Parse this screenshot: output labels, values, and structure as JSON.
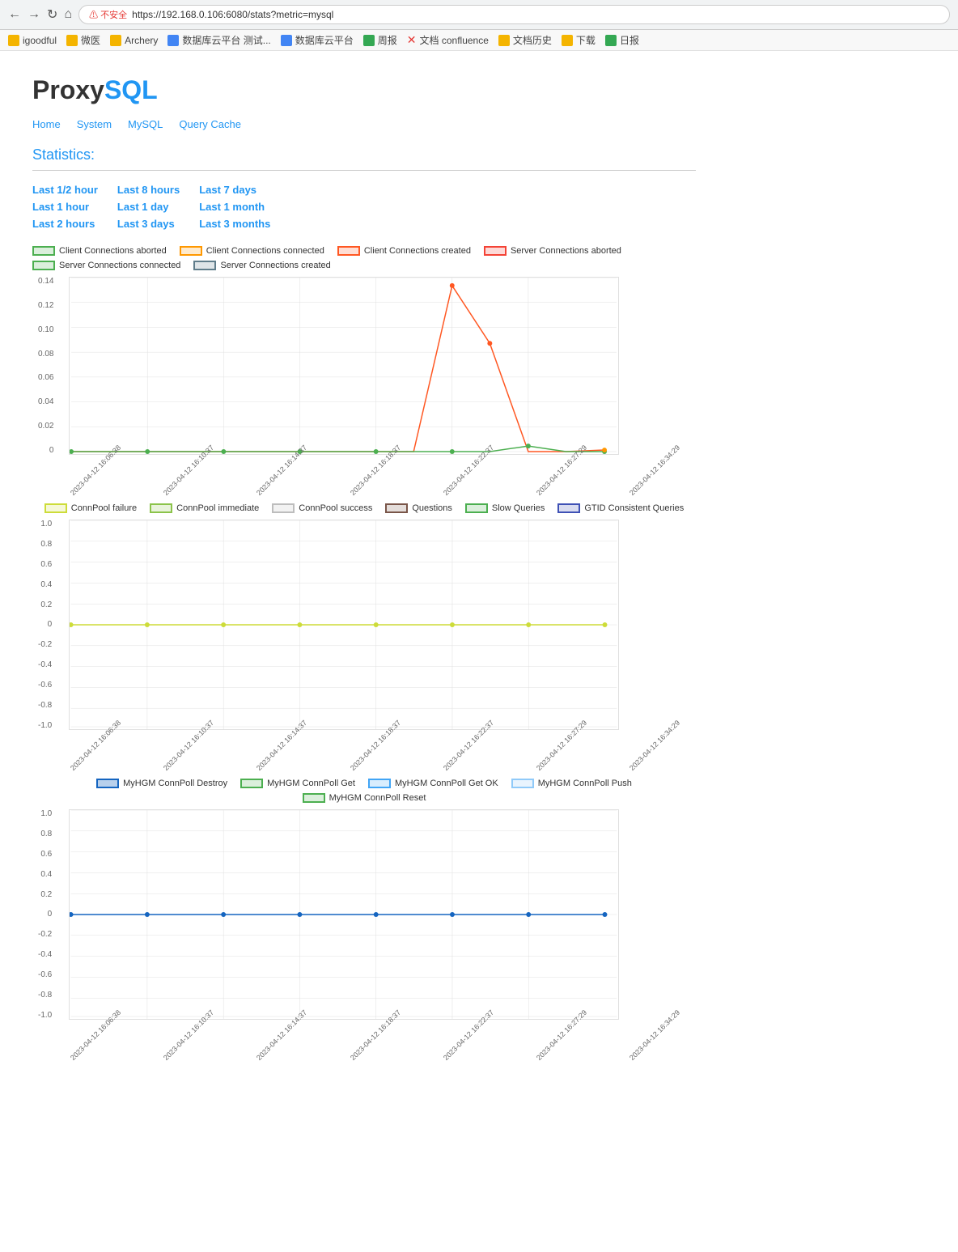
{
  "browser": {
    "back_label": "←",
    "forward_label": "→",
    "reload_label": "↻",
    "home_label": "⌂",
    "warning_text": "⚠ 不安全",
    "url": "https://192.168.0.106:6080/stats?metric=mysql",
    "bookmarks": [
      {
        "label": "igoodful",
        "color": "#f4b400"
      },
      {
        "label": "微医",
        "color": "#f4b400"
      },
      {
        "label": "Archery",
        "color": "#f4b400"
      },
      {
        "label": "数据库云平台 测试...",
        "color": "#4285f4"
      },
      {
        "label": "数据库云平台",
        "color": "#4285f4"
      },
      {
        "label": "周报",
        "color": "#34a853"
      },
      {
        "label": "文档 confluence",
        "color": "#4285f4"
      },
      {
        "label": "文档历史",
        "color": "#f4b400"
      },
      {
        "label": "下载",
        "color": "#f4b400"
      },
      {
        "label": "日报",
        "color": "#34a853"
      }
    ]
  },
  "logo": {
    "proxy": "Proxy",
    "sql": "SQL"
  },
  "nav": {
    "items": [
      "Home",
      "System",
      "MySQL",
      "Query Cache"
    ]
  },
  "statistics": {
    "title": "Statistics:"
  },
  "time_links": [
    "Last 1/2 hour",
    "Last 8 hours",
    "Last 7 days",
    "Last 1 hour",
    "Last 1 day",
    "Last 1 month",
    "Last 2 hours",
    "Last 3 days",
    "Last 3 months"
  ],
  "chart1": {
    "legend": [
      {
        "label": "Client Connections aborted",
        "color": "#4caf50",
        "bg": "transparent"
      },
      {
        "label": "Client Connections connected",
        "color": "#ff9800",
        "bg": "transparent"
      },
      {
        "label": "Client Connections created",
        "color": "#ff5722",
        "bg": "transparent"
      },
      {
        "label": "Server Connections aborted",
        "color": "#f44336",
        "bg": "transparent"
      },
      {
        "label": "Server Connections connected",
        "color": "#4caf50",
        "bg": "transparent"
      },
      {
        "label": "Server Connections created",
        "color": "#607d8b",
        "bg": "transparent"
      }
    ],
    "y_labels": [
      "0.14",
      "0.12",
      "0.10",
      "0.08",
      "0.06",
      "0.04",
      "0.02",
      "0"
    ],
    "x_labels": [
      "2023-04-12 16:06:38",
      "2023-04-12 16:10:37",
      "2023-04-12 16:14:37",
      "2023-04-12 16:18:37",
      "2023-04-12 16:22:37",
      "2023-04-12 16:27:29",
      "2023-04-12 16:34:29"
    ]
  },
  "chart2": {
    "legend": [
      {
        "label": "ConnPool failure",
        "color": "#cddc39",
        "bg": "transparent"
      },
      {
        "label": "ConnPool immediate",
        "color": "#8bc34a",
        "bg": "transparent"
      },
      {
        "label": "ConnPool success",
        "color": "#bdbdbd",
        "bg": "transparent"
      },
      {
        "label": "Questions",
        "color": "#795548",
        "bg": "transparent"
      },
      {
        "label": "Slow Queries",
        "color": "#4caf50",
        "bg": "transparent"
      },
      {
        "label": "GTID Consistent Queries",
        "color": "#3f51b5",
        "bg": "transparent"
      }
    ],
    "y_labels": [
      "1.0",
      "0.8",
      "0.6",
      "0.4",
      "0.2",
      "0",
      "-0.2",
      "-0.4",
      "-0.6",
      "-0.8",
      "-1.0"
    ],
    "x_labels": [
      "2023-04-12 16:06:38",
      "2023-04-12 16:10:37",
      "2023-04-12 16:14:37",
      "2023-04-12 16:18:37",
      "2023-04-12 16:22:37",
      "2023-04-12 16:27:29",
      "2023-04-12 16:34:29"
    ]
  },
  "chart3": {
    "legend": [
      {
        "label": "MyHGM ConnPoll Destroy",
        "color": "#1565c0",
        "bg": "transparent"
      },
      {
        "label": "MyHGM ConnPoll Get",
        "color": "#4caf50",
        "bg": "transparent"
      },
      {
        "label": "MyHGM ConnPoll Get OK",
        "color": "#42a5f5",
        "bg": "transparent"
      },
      {
        "label": "MyHGM ConnPoll Push",
        "color": "#90caf9",
        "bg": "transparent"
      },
      {
        "label": "MyHGM ConnPoll Reset",
        "color": "#4caf50",
        "bg": "transparent"
      }
    ],
    "y_labels": [
      "1.0",
      "0.8",
      "0.6",
      "0.4",
      "0.2",
      "0",
      "-0.2",
      "-0.4",
      "-0.6",
      "-0.8",
      "-1.0"
    ],
    "x_labels": [
      "2023-04-12 16:06:38",
      "2023-04-12 16:10:37",
      "2023-04-12 16:14:37",
      "2023-04-12 16:18:37",
      "2023-04-12 16:22:37",
      "2023-04-12 16:27:29",
      "2023-04-12 16:34:29"
    ]
  }
}
